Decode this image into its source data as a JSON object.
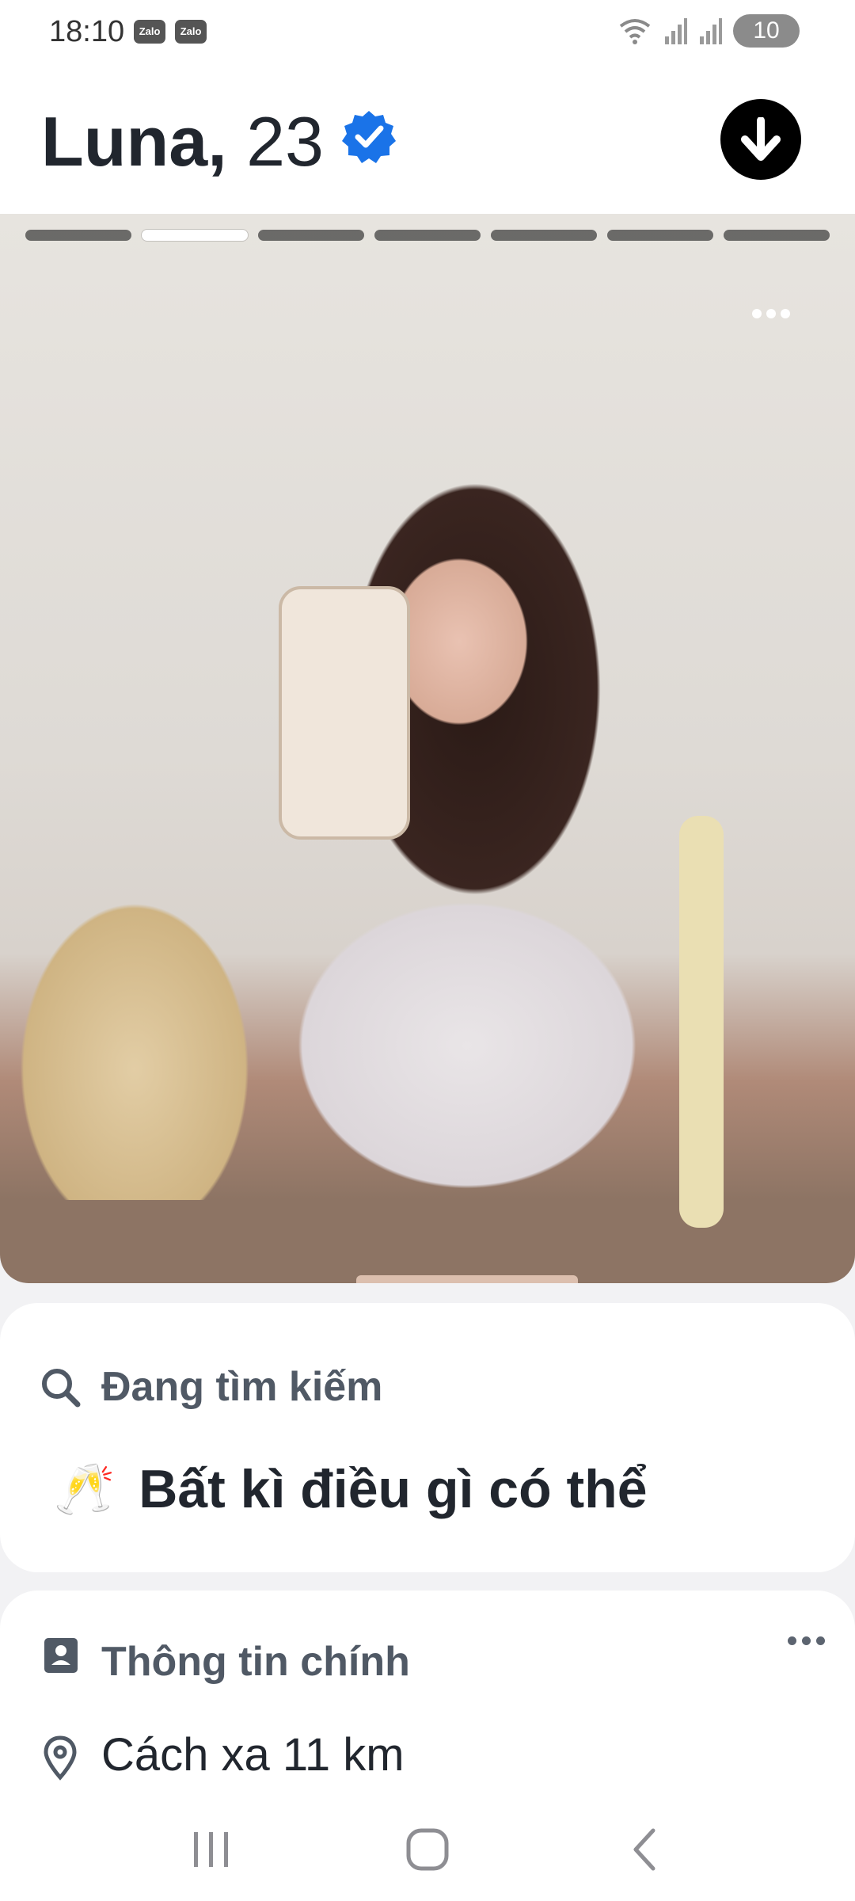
{
  "status_bar": {
    "time": "18:10",
    "apps": [
      "Zalo",
      "Zalo"
    ],
    "battery": "10",
    "icons": [
      "wifi-icon",
      "signal-icon",
      "signal-icon",
      "battery-charging-icon"
    ]
  },
  "profile": {
    "name": "Luna,",
    "age": "23",
    "verified_icon": "verified-badge-icon",
    "expand_icon": "arrow-down-icon"
  },
  "photo": {
    "total_photos": 7,
    "active_index": 1,
    "more_icon": "more-horizontal-icon"
  },
  "looking_for": {
    "title": "Đang tìm kiếm",
    "emoji": "🥂",
    "value": "Bất kì điều gì có thể",
    "icon": "search-icon"
  },
  "main_info": {
    "title": "Thông tin chính",
    "icon": "id-card-icon",
    "distance": "Cách xa 11 km",
    "distance_icon": "location-pin-icon"
  },
  "nav": {
    "buttons": [
      "recent-apps-icon",
      "home-icon",
      "back-icon"
    ]
  },
  "colors": {
    "verified_blue": "#1a73e8",
    "text_dark": "#21262e",
    "text_muted": "#505965"
  }
}
